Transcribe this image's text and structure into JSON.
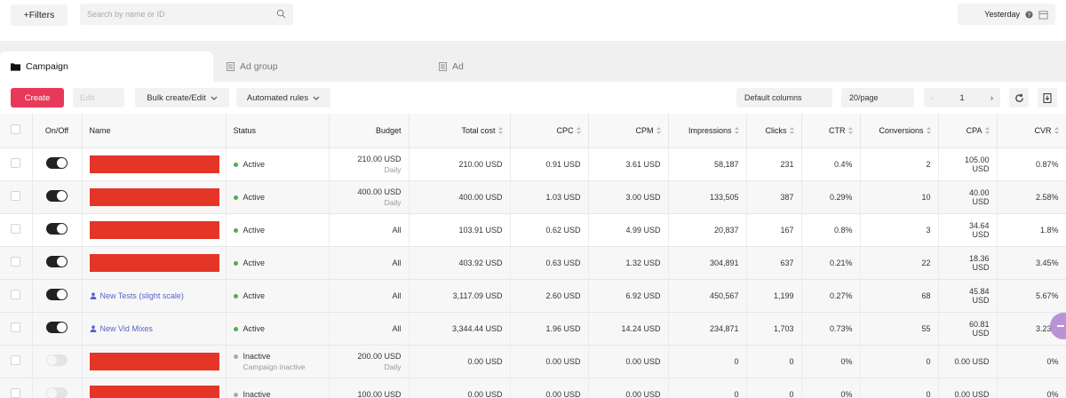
{
  "topbar": {
    "filters_label": "+Filters",
    "search_placeholder": "Search by name or ID",
    "date_label": "Yesterday"
  },
  "tabs": [
    {
      "label": "Campaign",
      "active": true
    },
    {
      "label": "Ad group",
      "active": false
    },
    {
      "label": "Ad",
      "active": false
    }
  ],
  "toolbar": {
    "create_label": "Create",
    "edit_label": "Edit",
    "bulk_label": "Bulk create/Edit",
    "rules_label": "Automated rules",
    "columns_label": "Default columns",
    "perpage_label": "20/page",
    "page_number": "1"
  },
  "table": {
    "headers": {
      "onoff": "On/Off",
      "name": "Name",
      "status": "Status",
      "budget": "Budget",
      "total_cost": "Total cost",
      "cpc": "CPC",
      "cpm": "CPM",
      "impressions": "Impressions",
      "clicks": "Clicks",
      "ctr": "CTR",
      "conversions": "Conversions",
      "cpa": "CPA",
      "cvr": "CVR"
    },
    "rows": [
      {
        "on": true,
        "name": "",
        "status": "Active",
        "status_sub": "",
        "budget": "210.00 USD",
        "budget_sub": "Daily",
        "total_cost": "210.00 USD",
        "cpc": "0.91 USD",
        "cpm": "3.61 USD",
        "impressions": "58,187",
        "clicks": "231",
        "ctr": "0.4%",
        "conversions": "2",
        "cpa": "105.00 USD",
        "cvr": "0.87%"
      },
      {
        "on": true,
        "name": "",
        "status": "Active",
        "status_sub": "",
        "budget": "400.00 USD",
        "budget_sub": "Daily",
        "total_cost": "400.00 USD",
        "cpc": "1.03 USD",
        "cpm": "3.00 USD",
        "impressions": "133,505",
        "clicks": "387",
        "ctr": "0.29%",
        "conversions": "10",
        "cpa": "40.00 USD",
        "cvr": "2.58%"
      },
      {
        "on": true,
        "name": "",
        "status": "Active",
        "status_sub": "",
        "budget": "All",
        "budget_sub": "",
        "total_cost": "103.91 USD",
        "cpc": "0.62 USD",
        "cpm": "4.99 USD",
        "impressions": "20,837",
        "clicks": "167",
        "ctr": "0.8%",
        "conversions": "3",
        "cpa": "34.64 USD",
        "cvr": "1.8%"
      },
      {
        "on": true,
        "name": "",
        "status": "Active",
        "status_sub": "",
        "budget": "All",
        "budget_sub": "",
        "total_cost": "403.92 USD",
        "cpc": "0.63 USD",
        "cpm": "1.32 USD",
        "impressions": "304,891",
        "clicks": "637",
        "ctr": "0.21%",
        "conversions": "22",
        "cpa": "18.36 USD",
        "cvr": "3.45%"
      },
      {
        "on": true,
        "name": "New Tests (slight scale)",
        "status": "Active",
        "status_sub": "",
        "budget": "All",
        "budget_sub": "",
        "total_cost": "3,117.09 USD",
        "cpc": "2.60 USD",
        "cpm": "6.92 USD",
        "impressions": "450,567",
        "clicks": "1,199",
        "ctr": "0.27%",
        "conversions": "68",
        "cpa": "45.84 USD",
        "cvr": "5.67%"
      },
      {
        "on": true,
        "name": "New Vid Mixes",
        "status": "Active",
        "status_sub": "",
        "budget": "All",
        "budget_sub": "",
        "total_cost": "3,344.44 USD",
        "cpc": "1.96 USD",
        "cpm": "14.24 USD",
        "impressions": "234,871",
        "clicks": "1,703",
        "ctr": "0.73%",
        "conversions": "55",
        "cpa": "60.81 USD",
        "cvr": "3.23%"
      },
      {
        "on": false,
        "name": "",
        "status": "Inactive",
        "status_sub": "Campaign inactive",
        "budget": "200.00 USD",
        "budget_sub": "Daily",
        "total_cost": "0.00 USD",
        "cpc": "0.00 USD",
        "cpm": "0.00 USD",
        "impressions": "0",
        "clicks": "0",
        "ctr": "0%",
        "conversions": "0",
        "cpa": "0.00 USD",
        "cvr": "0%"
      },
      {
        "on": false,
        "name": "",
        "status": "Inactive",
        "status_sub": "",
        "budget": "100.00 USD",
        "budget_sub": "",
        "total_cost": "0.00 USD",
        "cpc": "0.00 USD",
        "cpm": "0.00 USD",
        "impressions": "0",
        "clicks": "0",
        "ctr": "0%",
        "conversions": "0",
        "cpa": "0.00 USD",
        "cvr": "0%"
      }
    ]
  },
  "colors": {
    "create_button": "#e8395a",
    "redaction": "#e53527",
    "status_active": "#4caf50",
    "link": "#5a62c7"
  },
  "icons": [
    "search-icon",
    "help-icon",
    "calendar-icon",
    "folder-icon",
    "document-icon",
    "chevron-down-icon",
    "refresh-icon",
    "download-icon",
    "sort-icon",
    "user-group-icon",
    "toggle-icon"
  ]
}
